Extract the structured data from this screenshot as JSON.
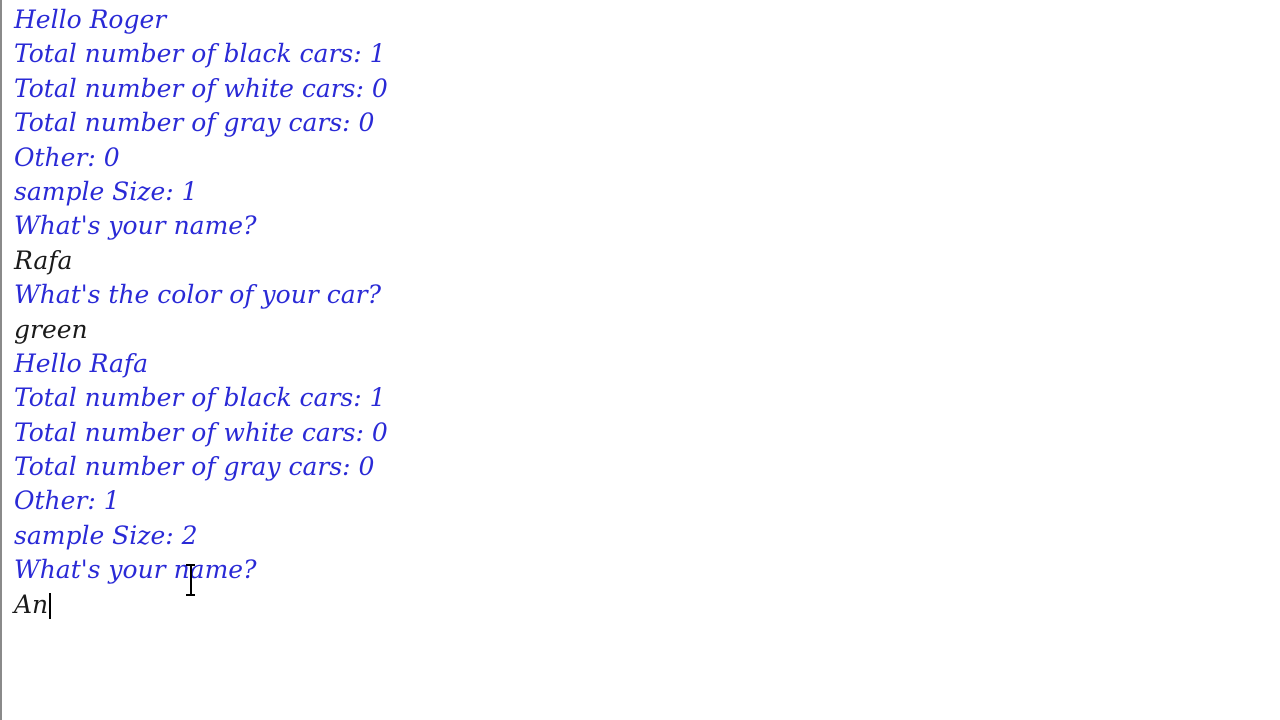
{
  "console": {
    "lines": [
      {
        "kind": "output",
        "text": "Hello Roger"
      },
      {
        "kind": "output",
        "text": "Total number of black cars: 1"
      },
      {
        "kind": "output",
        "text": "Total number of white cars: 0"
      },
      {
        "kind": "output",
        "text": "Total number of gray cars: 0"
      },
      {
        "kind": "output",
        "text": "Other: 0"
      },
      {
        "kind": "output",
        "text": "sample Size: 1"
      },
      {
        "kind": "output",
        "text": "What's your name?"
      },
      {
        "kind": "input",
        "text": "Rafa"
      },
      {
        "kind": "output",
        "text": "What's the color of your car?"
      },
      {
        "kind": "input",
        "text": "green"
      },
      {
        "kind": "output",
        "text": "Hello Rafa"
      },
      {
        "kind": "output",
        "text": "Total number of black cars: 1"
      },
      {
        "kind": "output",
        "text": "Total number of white cars: 0"
      },
      {
        "kind": "output",
        "text": "Total number of gray cars: 0"
      },
      {
        "kind": "output",
        "text": "Other: 1"
      },
      {
        "kind": "output",
        "text": "sample Size: 2"
      },
      {
        "kind": "output",
        "text": "What's your name?"
      }
    ],
    "current_input": "An"
  },
  "colors": {
    "output_text": "#2a2ad6",
    "input_text": "#1a1a1a",
    "background": "#ffffff"
  },
  "icons": {
    "mouse_cursor": "i-beam-cursor-icon"
  }
}
